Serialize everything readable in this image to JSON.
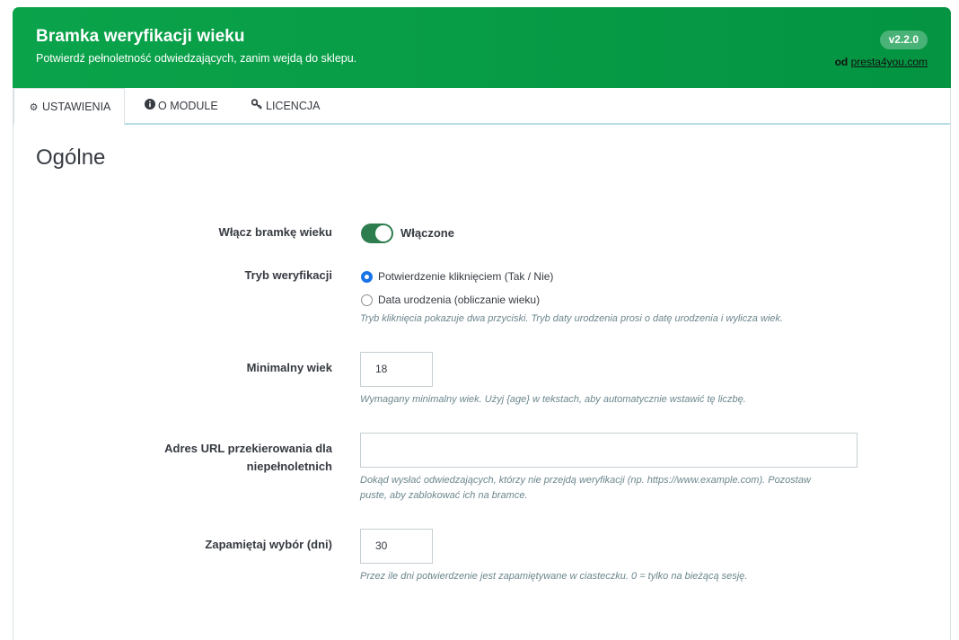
{
  "header": {
    "title": "Bramka weryfikacji wieku",
    "subtitle": "Potwierdź pełnoletność odwiedzających, zanim wejdą do sklepu.",
    "version": "v2.2.0",
    "author_prefix": "od",
    "author_link": "presta4you.com",
    "accent_color": "#0aa34a"
  },
  "tabs": [
    {
      "label": "USTAWIENIA",
      "icon": "gears-icon",
      "active": true
    },
    {
      "label": "O MODULE",
      "icon": "info-circle-icon",
      "active": false
    },
    {
      "label": "LICENCJA",
      "icon": "key-icon",
      "active": false
    }
  ],
  "section": {
    "title": "Ogólne"
  },
  "fields": {
    "enable": {
      "label": "Włącz bramkę wieku",
      "state_label": "Włączone",
      "enabled": true
    },
    "mode": {
      "label": "Tryb weryfikacji",
      "options": [
        {
          "label": "Potwierdzenie kliknięciem (Tak / Nie)",
          "checked": true
        },
        {
          "label": "Data urodzenia (obliczanie wieku)",
          "checked": false
        }
      ],
      "help": "Tryb kliknięcia pokazuje dwa przyciski. Tryb daty urodzenia prosi o datę urodzenia i wylicza wiek."
    },
    "min_age": {
      "label": "Minimalny wiek",
      "value": "18",
      "help": "Wymagany minimalny wiek. Użyj {age} w tekstach, aby automatycznie wstawić tę liczbę."
    },
    "redirect": {
      "label_line1": "Adres URL przekierowania dla",
      "label_line2": "niepełnoletnich",
      "value": "",
      "help_line1": "Dokąd wysłać odwiedzających, którzy nie przejdą weryfikacji (np. https://www.example.com). Pozostaw",
      "help_line2": "puste, aby zablokować ich na bramce."
    },
    "remember": {
      "label": "Zapamiętaj wybór (dni)",
      "value": "30",
      "help": "Przez ile dni potwierdzenie jest zapamiętywane w ciasteczku. 0 = tylko na bieżącą sesję."
    }
  }
}
